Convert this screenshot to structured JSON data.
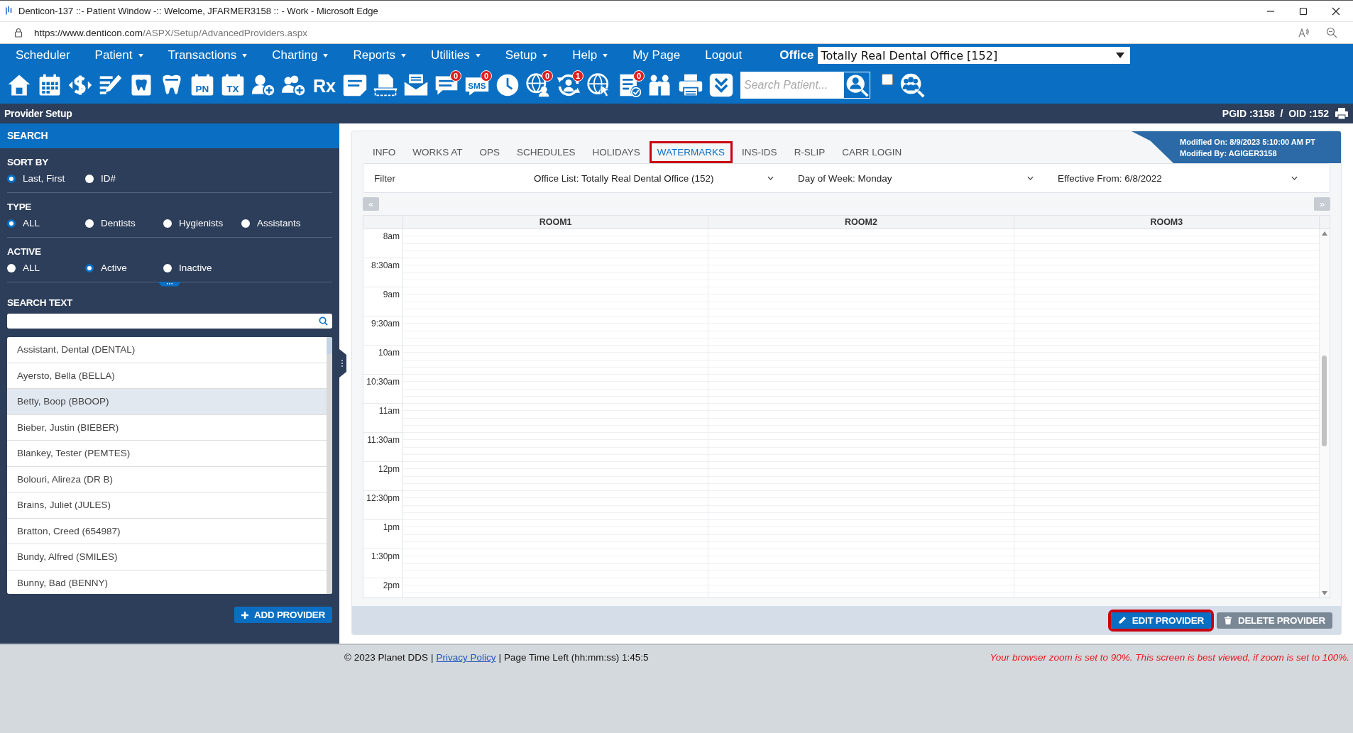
{
  "window": {
    "title": "Denticon-137 ::- Patient Window -:: Welcome, JFARMER3158 :: - Work - Microsoft Edge"
  },
  "address_bar": {
    "url_host": "https://www.denticon.com",
    "url_path": "/ASPX/Setup/AdvancedProviders.aspx"
  },
  "menu": [
    {
      "label": "Scheduler",
      "dropdown": false
    },
    {
      "label": "Patient",
      "dropdown": true
    },
    {
      "label": "Transactions",
      "dropdown": true
    },
    {
      "label": "Charting",
      "dropdown": true
    },
    {
      "label": "Reports",
      "dropdown": true
    },
    {
      "label": "Utilities",
      "dropdown": true
    },
    {
      "label": "Setup",
      "dropdown": true
    },
    {
      "label": "Help",
      "dropdown": true
    },
    {
      "label": "My Page",
      "dropdown": false
    },
    {
      "label": "Logout",
      "dropdown": false
    }
  ],
  "office": {
    "label": "Office",
    "value": "Totally Real Dental Office [152]"
  },
  "toolbar": {
    "labels": [
      "PN",
      "TX",
      "Rx",
      "SMS"
    ],
    "badges": [
      "0",
      "0",
      "0",
      "1",
      "0"
    ]
  },
  "patient_search": {
    "placeholder": "Search Patient...",
    "checked": false
  },
  "page_header": {
    "title": "Provider Setup",
    "ids": "PGID :3158  /  OID :152"
  },
  "sidebar": {
    "title": "SEARCH",
    "groups": [
      {
        "label": "SORT BY",
        "options": [
          {
            "label": "Last, First",
            "selected": true
          },
          {
            "label": "ID#",
            "selected": false
          }
        ]
      },
      {
        "label": "TYPE",
        "options": [
          {
            "label": "ALL",
            "selected": true
          },
          {
            "label": "Dentists",
            "selected": false
          },
          {
            "label": "Hygienists",
            "selected": false
          },
          {
            "label": "Assistants",
            "selected": false
          }
        ]
      },
      {
        "label": "ACTIVE",
        "options": [
          {
            "label": "ALL",
            "selected": false
          },
          {
            "label": "Active",
            "selected": true
          },
          {
            "label": "Inactive",
            "selected": false
          }
        ]
      }
    ],
    "search_label": "SEARCH TEXT",
    "providers": [
      {
        "name": "Assistant, Dental (DENTAL)",
        "selected": false
      },
      {
        "name": "Ayersto, Bella (BELLA)",
        "selected": false
      },
      {
        "name": "Betty, Boop (BBOOP)",
        "selected": true
      },
      {
        "name": "Bieber, Justin (BIEBER)",
        "selected": false
      },
      {
        "name": "Blankey, Tester (PEMTES)",
        "selected": false
      },
      {
        "name": "Bolouri, Alireza (DR B)",
        "selected": false
      },
      {
        "name": "Brains, Juliet (JULES)",
        "selected": false
      },
      {
        "name": "Bratton, Creed (654987)",
        "selected": false
      },
      {
        "name": "Bundy, Alfred (SMILES)",
        "selected": false
      },
      {
        "name": "Bunny, Bad (BENNY)",
        "selected": false
      }
    ],
    "add_button": "ADD PROVIDER"
  },
  "tabs": [
    {
      "label": "INFO",
      "selected": false
    },
    {
      "label": "WORKS AT",
      "selected": false
    },
    {
      "label": "OPS",
      "selected": false
    },
    {
      "label": "SCHEDULES",
      "selected": false
    },
    {
      "label": "HOLIDAYS",
      "selected": false
    },
    {
      "label": "WATERMARKS",
      "selected": true
    },
    {
      "label": "INS-IDS",
      "selected": false
    },
    {
      "label": "R-SLIP",
      "selected": false
    },
    {
      "label": "CARR LOGIN",
      "selected": false
    }
  ],
  "modified": {
    "on": "Modified On: 8/9/2023 5:10:00 AM PT",
    "by": "Modified By: AGIGER3158"
  },
  "filter": {
    "label": "Filter",
    "selects": [
      "Office List: Totally Real Dental Office (152)",
      "Day of Week: Monday",
      "Effective From: 6/8/2022"
    ]
  },
  "schedule": {
    "prev": "«",
    "next": "»",
    "columns": [
      "ROOM1",
      "ROOM2",
      "ROOM3"
    ],
    "times": [
      "8am",
      "8:30am",
      "9am",
      "9:30am",
      "10am",
      "10:30am",
      "11am",
      "11:30am",
      "12pm",
      "12:30pm",
      "1pm",
      "1:30pm",
      "2pm"
    ]
  },
  "actions": [
    {
      "label": "EDIT PROVIDER",
      "kind": "primary",
      "highlighted": true
    },
    {
      "label": "DELETE PROVIDER",
      "kind": "secondary",
      "highlighted": false
    }
  ],
  "footer": {
    "copyright": "© 2023 Planet DDS",
    "separator_1": "|",
    "privacy": "Privacy Policy",
    "separator_2": "|",
    "time_left": "Page Time Left (hh:mm:ss) 1:45:5",
    "zoom_warning": "Your browser zoom is set to 90%. This screen is best viewed, if zoom is set to 100%."
  }
}
